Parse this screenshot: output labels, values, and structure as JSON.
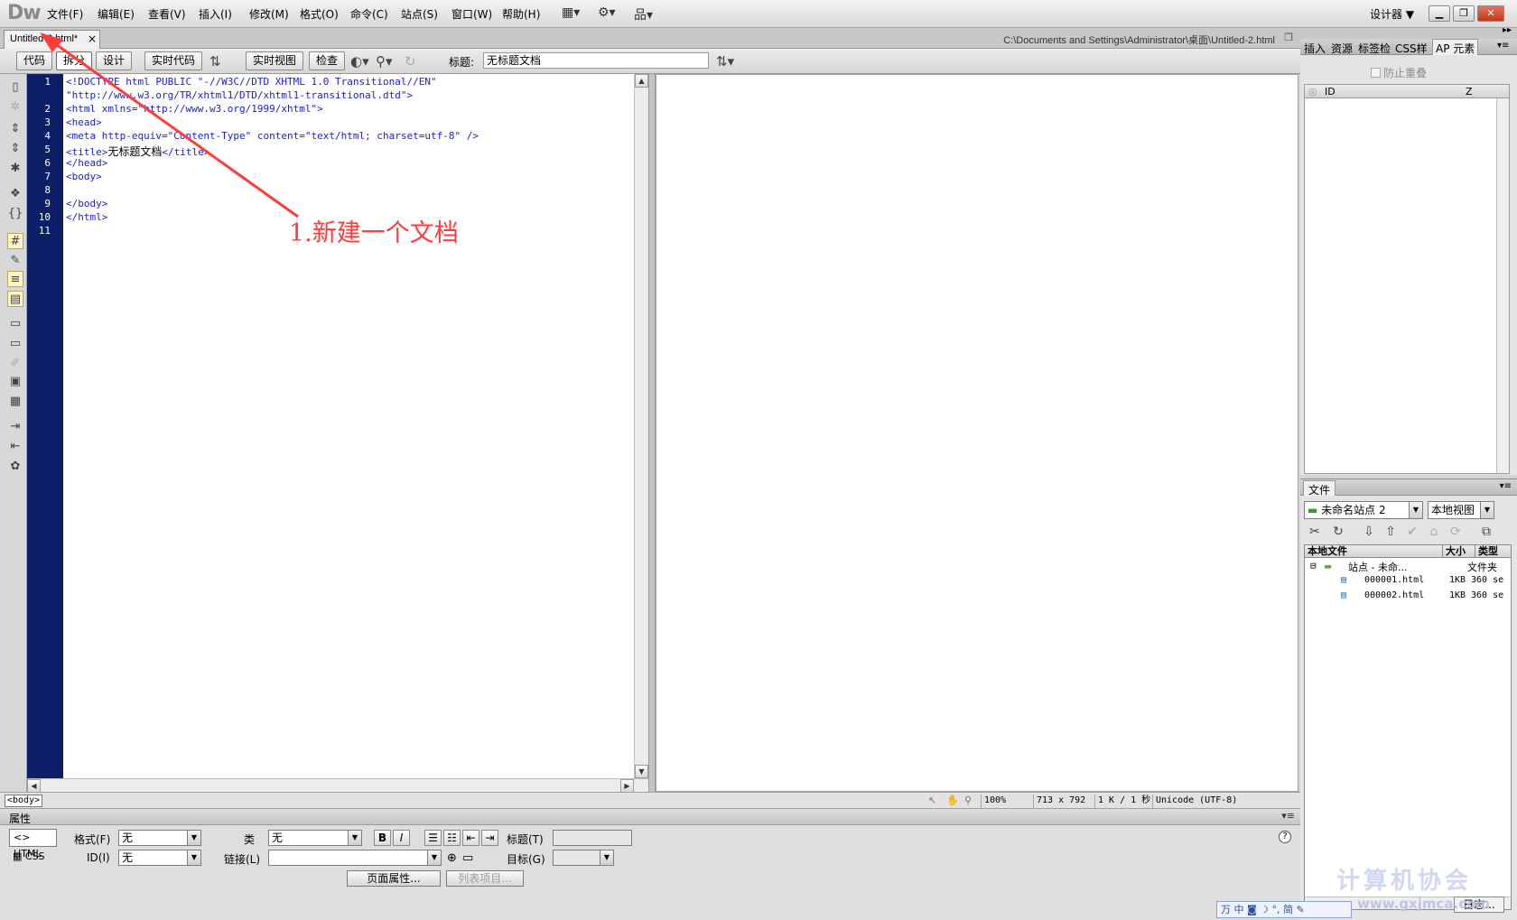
{
  "app": {
    "logo": "Dw",
    "menus": [
      "文件(F)",
      "编辑(E)",
      "查看(V)",
      "插入(I)",
      "修改(M)",
      "格式(O)",
      "命令(C)",
      "站点(S)",
      "窗口(W)",
      "帮助(H)"
    ],
    "workspace_label": "设计器 ▼"
  },
  "document": {
    "tab_label": "Untitled-2.html*",
    "tab_close": "×",
    "path": "C:\\Documents and Settings\\Administrator\\桌面\\Untitled-2.html"
  },
  "doc_toolbar": {
    "code_btn": "代码",
    "split_btn": "拆分",
    "design_btn": "设计",
    "live_code_btn": "实时代码",
    "live_view_btn": "实时视图",
    "inspect_btn": "检查",
    "title_label": "标题:",
    "title_value": "无标题文档"
  },
  "code": {
    "line_numbers": [
      "1",
      "",
      "2",
      "3",
      "4",
      "5",
      "6",
      "7",
      "8",
      "9",
      "10",
      "11"
    ],
    "lines": [
      "<!DOCTYPE html PUBLIC \"-//W3C//DTD XHTML 1.0 Transitional//EN\"",
      "\"http://www.w3.org/TR/xhtml1/DTD/xhtml1-transitional.dtd\">",
      "<html xmlns=\"http://www.w3.org/1999/xhtml\">",
      "<head>",
      "<meta http-equiv=\"Content-Type\" content=\"text/html; charset=utf-8\" />",
      "<title>",
      "</head>",
      "<body>",
      "",
      "</body>",
      "</html>",
      ""
    ],
    "title_text": "无标题文档",
    "title_close": "</title>"
  },
  "annotation": {
    "text": "1.新建一个文档",
    "color": "#ff3b3b"
  },
  "status": {
    "tag": "<body>",
    "zoom": "100%",
    "dimensions": "713 x 792",
    "size_time": "1 K / 1 秒",
    "encoding": "Unicode (UTF-8)"
  },
  "properties": {
    "title": "属性",
    "html_mode": "HTML",
    "css_mode": "CSS",
    "format_label": "格式(F)",
    "format_value": "无",
    "id_label": "ID(I)",
    "id_value": "无",
    "class_label": "类",
    "class_value": "无",
    "link_label": "链接(L)",
    "link_value": "",
    "bold": "B",
    "italic": "I",
    "heading_label": "标题(T)",
    "target_label": "目标(G)",
    "page_props_btn": "页面属性...",
    "list_item_btn": "列表项目...",
    "help": "?"
  },
  "right_panel": {
    "tabs": [
      "插入",
      "资源",
      "标签检",
      "CSS样",
      "AP 元素"
    ],
    "prevent_overlap": "防止重叠",
    "ap_col_id": "ID",
    "ap_col_z": "Z"
  },
  "files_panel": {
    "tab": "文件",
    "site_select": "未命名站点 2",
    "view_select": "本地视图",
    "col_local": "本地文件",
    "col_size": "大小",
    "col_type": "类型",
    "root_label": "站点 - 未命...",
    "root_type": "文件夹",
    "files": [
      {
        "name": "000001.html",
        "size": "1KB",
        "type": "360 se"
      },
      {
        "name": "000002.html",
        "size": "1KB",
        "type": "360 se"
      }
    ],
    "log_button": "日志..."
  },
  "watermark": {
    "text": "计算机协会",
    "url": "www.gxjmca.com"
  },
  "ime": {
    "label": "万 中 ◙ ☽ °, 简 ✎"
  }
}
